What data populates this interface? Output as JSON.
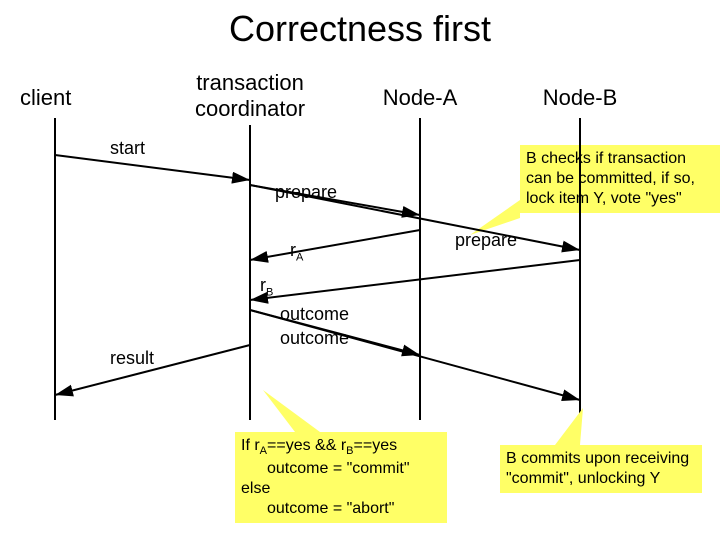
{
  "title": "Correctness first",
  "actors": {
    "client": "client",
    "tc_line1": "transaction",
    "tc_line2": "coordinator",
    "nodeA": "Node-A",
    "nodeB": "Node-B"
  },
  "messages": {
    "start": "start",
    "prepare1": "prepare",
    "prepare2": "prepare",
    "rA_prefix": "r",
    "rA_sub": "A",
    "rB_prefix": "r",
    "rB_sub": "B",
    "outcome1": "outcome",
    "outcome2": "outcome",
    "result": "result"
  },
  "callouts": {
    "check": "B checks if transaction can be committed, if so, lock item Y, vote \"yes\"",
    "logic_l1_pre": "If r",
    "logic_l1_mid": "==yes && r",
    "logic_l1_post": "==yes",
    "logic_l2": "outcome = \"commit\"",
    "logic_l3": "else",
    "logic_l4": "outcome = \"abort\"",
    "commit": "B commits upon receiving \"commit\", unlocking Y"
  },
  "subs": {
    "A": "A",
    "B": "B"
  }
}
